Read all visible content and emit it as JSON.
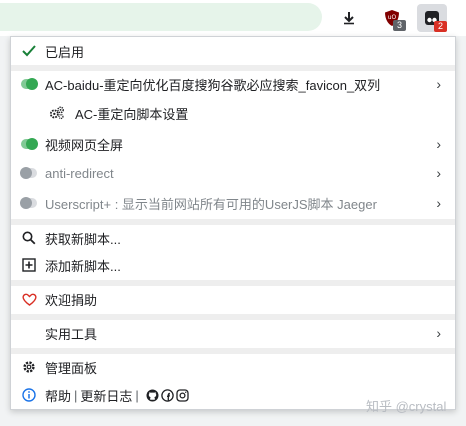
{
  "toolbar": {
    "icons": [
      "download-icon",
      "ublock-icon",
      "tampermonkey-icon"
    ],
    "ublock_badge": "3",
    "tampermonkey_badge": "2"
  },
  "menu": {
    "enabled_label": "已启用",
    "scripts": [
      {
        "label": "AC-baidu-重定向优化百度搜狗谷歌必应搜索_favicon_双列",
        "enabled": true
      },
      {
        "label": "AC-重定向脚本设置"
      },
      {
        "label": "视频网页全屏",
        "enabled": true
      },
      {
        "label": "anti-redirect",
        "enabled": false
      },
      {
        "label": "Userscript+ : 显示当前网站所有可用的UserJS脚本 Jaeger",
        "enabled": false
      }
    ],
    "find_scripts": "获取新脚本...",
    "add_script": "添加新脚本...",
    "donate": "欢迎捐助",
    "utilities": "实用工具",
    "dashboard": "管理面板",
    "help": "帮助",
    "divider": "|",
    "changelog": "更新日志"
  },
  "watermark": "知乎 @crystal",
  "colors": {
    "toggle_on": "#34a853",
    "toggle_off": "#9aa0a6",
    "check": "#188038",
    "heart": "#d93025",
    "info": "#1a73e8"
  }
}
